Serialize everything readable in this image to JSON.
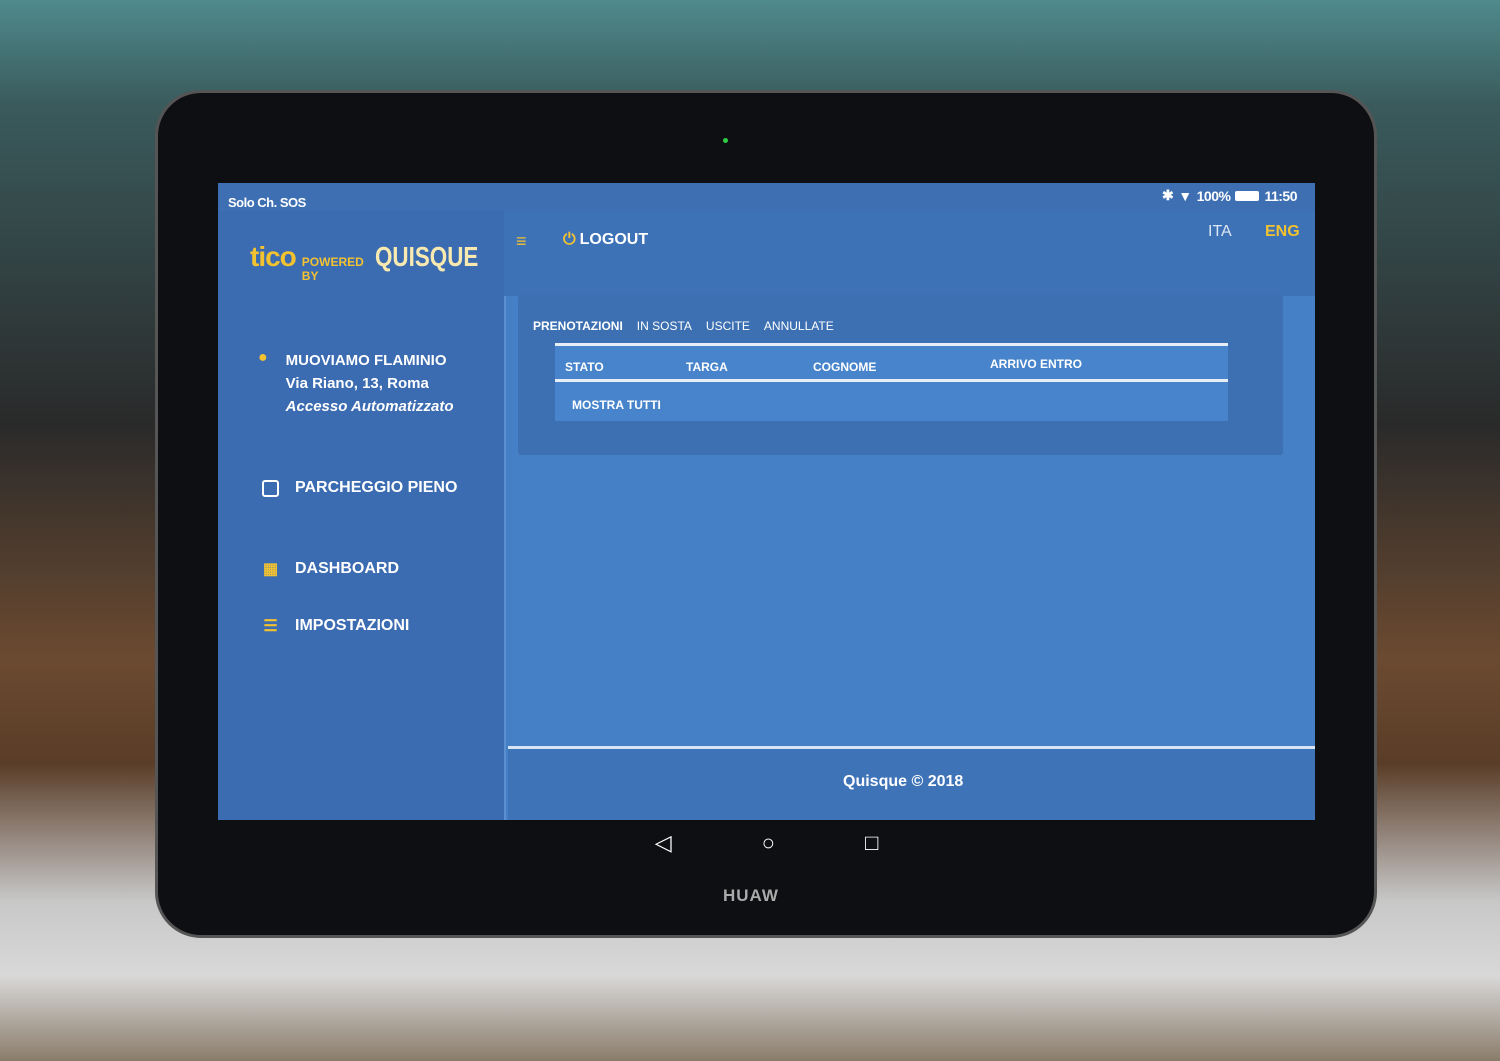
{
  "status_bar": {
    "carrier": "Solo Ch. SOS",
    "battery": "100%",
    "time": "11:50"
  },
  "brand": {
    "logo_tico": "tico",
    "powered_by": "POWERED BY",
    "logo_quisque": "QUISQUE",
    "device": "HUAW"
  },
  "header": {
    "logout": "LOGOUT",
    "languages": [
      "ITA",
      "ENG"
    ],
    "active_language": "ENG"
  },
  "location": {
    "name": "MUOVIAMO FLAMINIO",
    "address": "Via Riano, 13, Roma",
    "access": "Accesso Automatizzato"
  },
  "sidebar": {
    "items": [
      {
        "label": "PARCHEGGIO PIENO",
        "icon": "checkbox"
      },
      {
        "label": "DASHBOARD",
        "icon": "grid-icon"
      },
      {
        "label": "IMPOSTAZIONI",
        "icon": "sliders-icon"
      }
    ]
  },
  "tabs": [
    "PRENOTAZIONI",
    "IN SOSTA",
    "USCITE",
    "ANNULLATE"
  ],
  "active_tab": "PRENOTAZIONI",
  "table": {
    "columns": [
      "STATO",
      "TARGA",
      "COGNOME",
      "ARRIVO ENTRO"
    ],
    "show_all": "MOSTRA TUTTI"
  },
  "footer": {
    "text": "Quisque © 2018"
  },
  "colors": {
    "accent": "#f2c230",
    "background": "#3d6fb2"
  }
}
